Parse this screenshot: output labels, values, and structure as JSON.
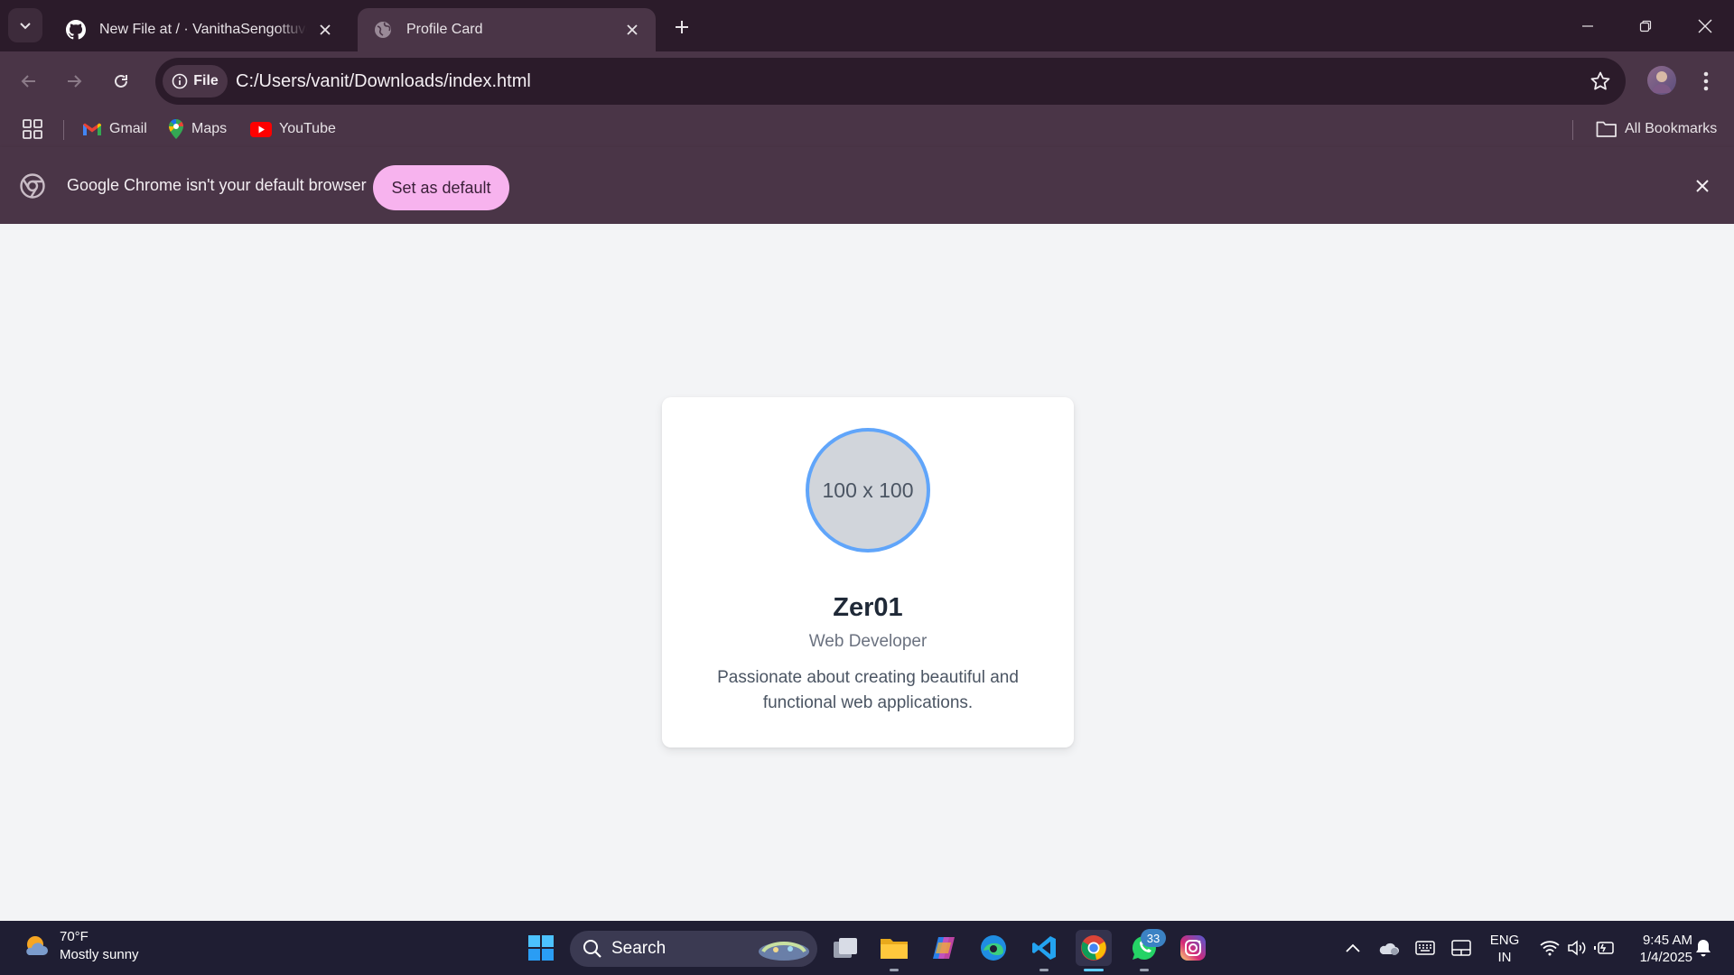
{
  "browser": {
    "tabs": [
      {
        "title": "New File at / · VanithaSengottuvel/",
        "favicon": "github-icon",
        "active": false
      },
      {
        "title": "Profile Card",
        "favicon": "globe-icon",
        "active": true
      }
    ],
    "security_chip": "File",
    "url": "C:/Users/vanit/Downloads/index.html",
    "bookmarks": [
      {
        "label": "Gmail",
        "icon": "gmail-icon"
      },
      {
        "label": "Maps",
        "icon": "maps-icon"
      },
      {
        "label": "YouTube",
        "icon": "youtube-icon"
      }
    ],
    "all_bookmarks": "All Bookmarks",
    "infobar": {
      "message": "Google Chrome isn't your default browser",
      "button": "Set as default"
    }
  },
  "page": {
    "card": {
      "image_placeholder": "100 x 100",
      "name": "Zer01",
      "role": "Web Developer",
      "bio": "Passionate about creating beautiful and functional web applications."
    }
  },
  "taskbar": {
    "weather": {
      "temp": "70°F",
      "condition": "Mostly sunny"
    },
    "search_label": "Search",
    "whatsapp_badge": "33",
    "language": {
      "line1": "ENG",
      "line2": "IN"
    },
    "clock": {
      "time": "9:45 AM",
      "date": "1/4/2025"
    }
  },
  "colors": {
    "tabstrip": "#2b1b2a",
    "toolbar": "#4a3547",
    "default_button": "#f7b3ee",
    "avatar_ring": "#60a5fa",
    "page_bg": "#f3f4f6",
    "taskbar": "#1f1e33"
  }
}
